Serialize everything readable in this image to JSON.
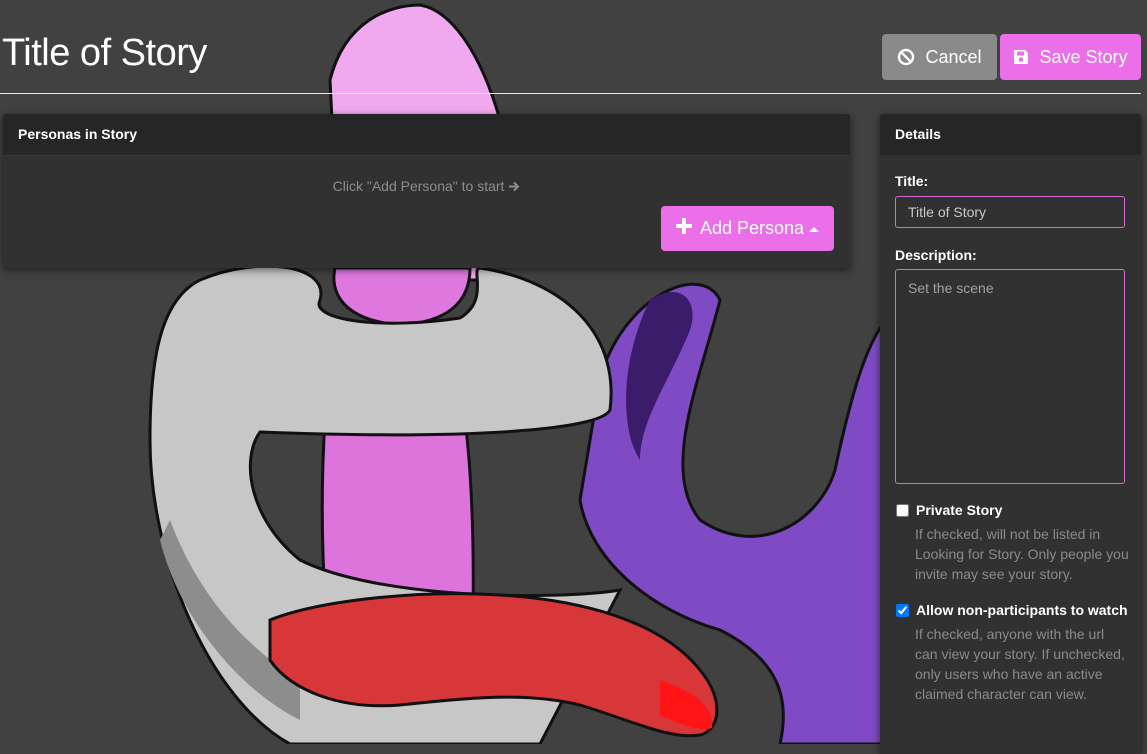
{
  "header": {
    "title": "Title of Story",
    "cancel_label": "Cancel",
    "save_label": "Save Story"
  },
  "personas": {
    "heading": "Personas in Story",
    "empty_hint": "Click \"Add Persona\" to start",
    "add_label": "Add Persona"
  },
  "details": {
    "heading": "Details",
    "title_label": "Title:",
    "title_value": "Title of Story",
    "description_label": "Description:",
    "description_placeholder": "Set the scene",
    "private_label": "Private Story",
    "private_checked": false,
    "private_help": "If checked, will not be listed in Looking for Story. Only people you invite may see your story.",
    "watch_label": "Allow non-participants to watch",
    "watch_checked": true,
    "watch_help": "If checked, anyone with the url can view your story. If unchecked, only users who have an active claimed character can view."
  },
  "colors": {
    "accent": "#ea6fe8",
    "cancel": "#8a8a8a",
    "panel": "#313131",
    "panel_heading": "#262626",
    "background": "#414141"
  },
  "icons": {
    "cancel": "ban-icon",
    "save": "floppy-disk-icon",
    "add": "plus-icon",
    "hint_arrow": "arrow-right-icon",
    "dropdown": "caret-up-icon"
  }
}
